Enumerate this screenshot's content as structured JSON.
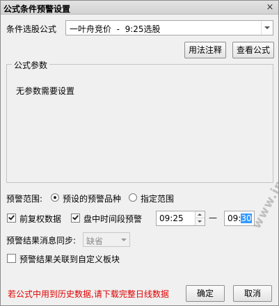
{
  "window": {
    "title": "公式条件预警设置",
    "close_glyph": "×"
  },
  "condition": {
    "label": "条件选股公式",
    "selected": "一叶舟竞价  -  9:25选股"
  },
  "buttons": {
    "usage_notes": "用法注释",
    "view_formula": "查看公式",
    "ok": "确定",
    "cancel": "取消"
  },
  "params": {
    "group_title": "公式参数",
    "message": "无参数需要设置"
  },
  "scope": {
    "label": "预警范围:",
    "option_preset": "预设的预警品种",
    "option_specified": "指定范围",
    "selected": "preset"
  },
  "adjust": {
    "label": "前复权数据",
    "checked": true
  },
  "intraday": {
    "label": "盘中时间段预警",
    "checked": true,
    "start_time": "09:25",
    "dash": "—",
    "end_hour": "09:",
    "end_minute": "30"
  },
  "sync": {
    "label": "预警结果消息同步:",
    "value": "缺省"
  },
  "link_block": {
    "label": "预警结果关联到自定义板块",
    "checked": false
  },
  "warning_text": "若公式中用到历史数据,请下载完整日线数据",
  "watermark": "www.jpzbw.cn",
  "colors": {
    "warning": "#e00000",
    "selection": "#3399ff"
  }
}
